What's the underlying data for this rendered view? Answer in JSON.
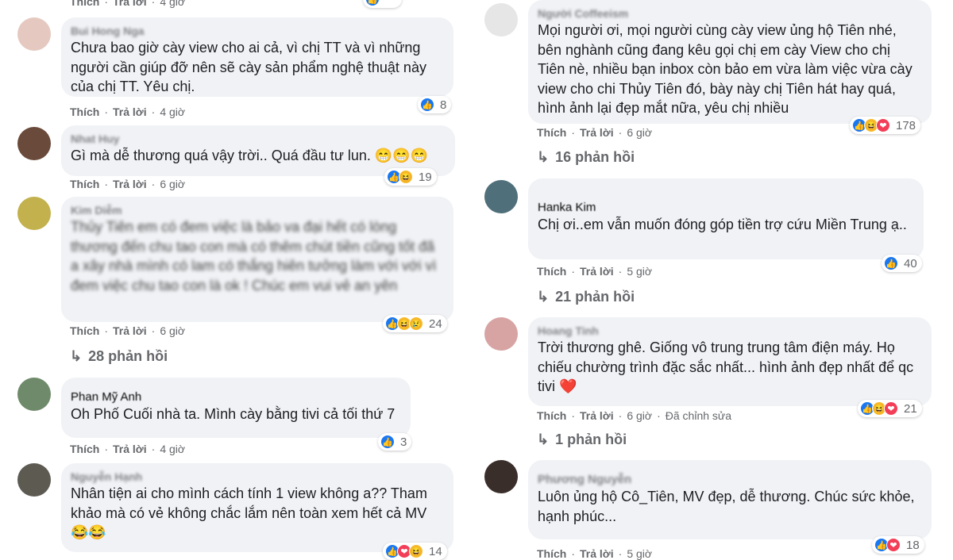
{
  "left": {
    "c0": {
      "actions": {
        "like": "Thích",
        "reply": "Trả lời",
        "time": "4 giờ"
      }
    },
    "c1": {
      "name": "Bui Hong Nga",
      "text": "Chưa bao giờ cày view cho ai cả, vì chị TT và vì những người cần giúp đỡ nên sẽ cày sản phẩm nghệ thuật này của chị TT. Yêu chị.",
      "reaction_count": "8",
      "actions": {
        "like": "Thích",
        "reply": "Trả lời",
        "time": "4 giờ"
      }
    },
    "c2": {
      "name": "Nhat Huy",
      "text": "Gì mà dễ thương quá vậy trời.. Quá đầu tư lun. 😁😁😁",
      "reaction_count": "19",
      "actions": {
        "like": "Thích",
        "reply": "Trả lời",
        "time": "6 giờ"
      }
    },
    "c3": {
      "name": "Kim Diễm",
      "text": "Thủy Tiên em có đem việc là bảo va đại hết có lòng thương đến chu tao con mà có thêm chút tiền cũng tốt đã a xây nhà mình có lam có thắng hiên tưởng làm với với vì đem việc chu tao con là ok ! Chúc em vui vẻ an yên",
      "reaction_count": "24",
      "actions": {
        "like": "Thích",
        "reply": "Trả lời",
        "time": "6 giờ"
      },
      "replies": "28 phản hồi"
    },
    "c4": {
      "name": "Phan Mỹ Anh",
      "text": "Oh Phố Cuối nhà ta. Mình cày bằng tivi cả tối thứ 7",
      "reaction_count": "3",
      "actions": {
        "like": "Thích",
        "reply": "Trả lời",
        "time": "4 giờ"
      }
    },
    "c5": {
      "name": "Nguyễn Hạnh",
      "text": "Nhân tiện ai cho mình cách tính 1 view không a?? Tham khảo mà có vẻ không chắc lắm nên toàn xem hết cả MV 😂😂",
      "reaction_count": "14"
    }
  },
  "right": {
    "c1": {
      "name": "Người Coffeeism",
      "text": "Mọi người ơi, mọi người cùng cày view ủng hộ Tiên nhé, bên nghành cũng đang kêu gọi chị em cày View cho chị Tiên nè, nhiều bạn inbox còn bảo em vừa làm việc vừa cày view cho chi Thủy Tiên đó, bày này chị Tiên hát hay quá, hình ảnh lại đẹp mắt nữa, yêu chị nhiều",
      "reaction_count": "178",
      "actions": {
        "like": "Thích",
        "reply": "Trả lời",
        "time": "6 giờ"
      },
      "replies": "16 phản hồi"
    },
    "c2": {
      "name": "Hanka Kim",
      "text": "Chị ơi..em vẫn muốn đóng góp tiền trợ cứu Miền Trung ạ..",
      "reaction_count": "40",
      "actions": {
        "like": "Thích",
        "reply": "Trả lời",
        "time": "5 giờ"
      },
      "replies": "21 phản hồi"
    },
    "c3": {
      "name": "Hoang Tinh",
      "text": "Trời thương ghê. Giống vô trung trung tâm điện máy. Họ chiếu chường trình đặc sắc nhất... hình ảnh đẹp nhất để qc tivi ❤️",
      "reaction_count": "21",
      "actions": {
        "like": "Thích",
        "reply": "Trả lời",
        "time": "6 giờ",
        "edited": "Đã chỉnh sửa"
      },
      "replies": "1 phản hồi"
    },
    "c4": {
      "name": "Phương Nguyễn",
      "text": "Luôn ủng hộ Cô_Tiên, MV đẹp, dễ thương. Chúc sức khỏe, hạnh phúc...",
      "reaction_count": "18",
      "actions": {
        "like": "Thích",
        "reply": "Trả lời",
        "time": "5 giờ"
      }
    }
  },
  "icons": {
    "like": "👍",
    "haha": "😆",
    "love": "❤",
    "sad": "😢",
    "reply_arrow": "↳"
  }
}
